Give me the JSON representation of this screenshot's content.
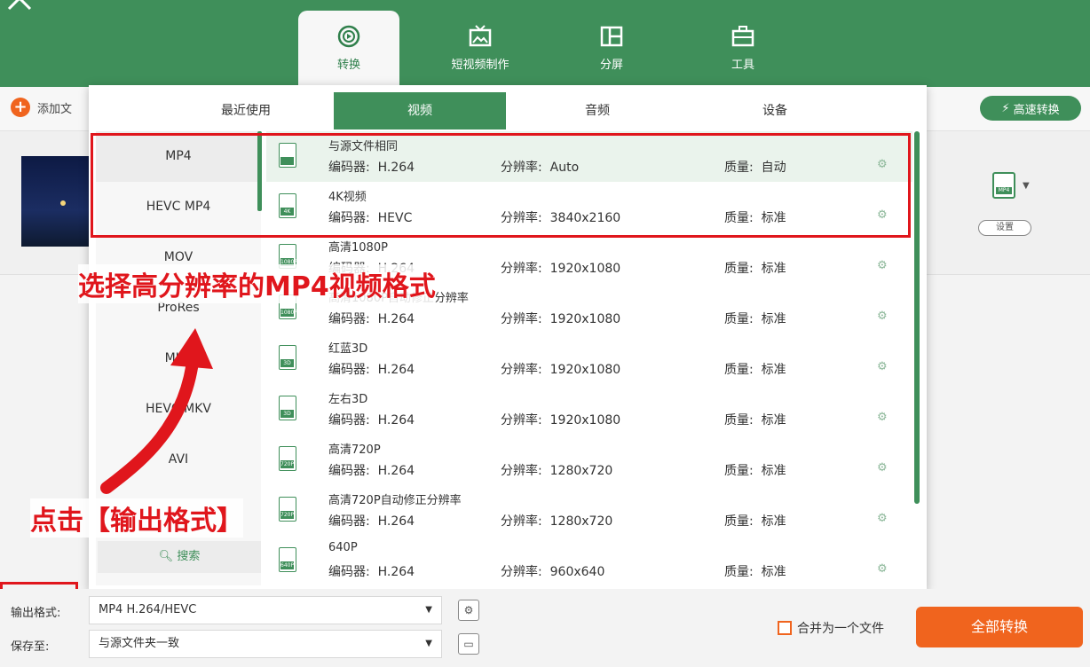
{
  "app": {
    "nav_tabs": [
      {
        "label": "转换",
        "icon": "convert-icon"
      },
      {
        "label": "短视频制作",
        "icon": "tv-icon"
      },
      {
        "label": "分屏",
        "icon": "split-screen-icon"
      },
      {
        "label": "工具",
        "icon": "toolbox-icon"
      }
    ],
    "active_nav": "转换"
  },
  "toolbar": {
    "add_file_label": "添加文",
    "fast_convert_label": "高速转换"
  },
  "file_item": {
    "settings_label": "设置",
    "format_tag": "MP4"
  },
  "format_panel": {
    "tabs": [
      "最近使用",
      "视频",
      "音频",
      "设备"
    ],
    "active_tab": "视频",
    "categories": [
      "MP4",
      "HEVC MP4",
      "MOV",
      "ProRes",
      "MKV",
      "HEVC MKV",
      "AVI"
    ],
    "active_category": "MP4",
    "search_label": "搜索",
    "encoder_label": "编码器:",
    "resolution_label": "分辨率:",
    "quality_label": "质量:",
    "formats": [
      {
        "name": "与源文件相同",
        "encoder": "H.264",
        "resolution": "Auto",
        "quality": "自动",
        "tag": ""
      },
      {
        "name": "4K视频",
        "encoder": "HEVC",
        "resolution": "3840x2160",
        "quality": "标准",
        "tag": "4K"
      },
      {
        "name": "高清1080P",
        "encoder": "H.264",
        "resolution": "1920x1080",
        "quality": "标准",
        "tag": "1080P"
      },
      {
        "name": "高清1080P自动修正分辨率",
        "encoder": "H.264",
        "resolution": "1920x1080",
        "quality": "标准",
        "tag": "1080P"
      },
      {
        "name": "红蓝3D",
        "encoder": "H.264",
        "resolution": "1920x1080",
        "quality": "标准",
        "tag": "3D"
      },
      {
        "name": "左右3D",
        "encoder": "H.264",
        "resolution": "1920x1080",
        "quality": "标准",
        "tag": "3D"
      },
      {
        "name": "高清720P",
        "encoder": "H.264",
        "resolution": "1280x720",
        "quality": "标准",
        "tag": "720P"
      },
      {
        "name": "高清720P自动修正分辨率",
        "encoder": "H.264",
        "resolution": "1280x720",
        "quality": "标准",
        "tag": "720P"
      },
      {
        "name": "640P",
        "encoder": "H.264",
        "resolution": "960x640",
        "quality": "标准",
        "tag": "640P"
      }
    ]
  },
  "annotations": {
    "choose_format": "选择高分辨率的MP4视频格式",
    "click_output": "点击【输出格式】"
  },
  "bottom": {
    "output_format_label": "输出格式:",
    "output_format_value": "MP4 H.264/HEVC",
    "save_to_label": "保存至:",
    "save_to_value": "与源文件夹一致",
    "merge_label": "合并为一个文件",
    "convert_all_label": "全部转换"
  },
  "colors": {
    "brand_green": "#3f8f5a",
    "accent_orange": "#f0641e",
    "annotation_red": "#e0161c"
  }
}
